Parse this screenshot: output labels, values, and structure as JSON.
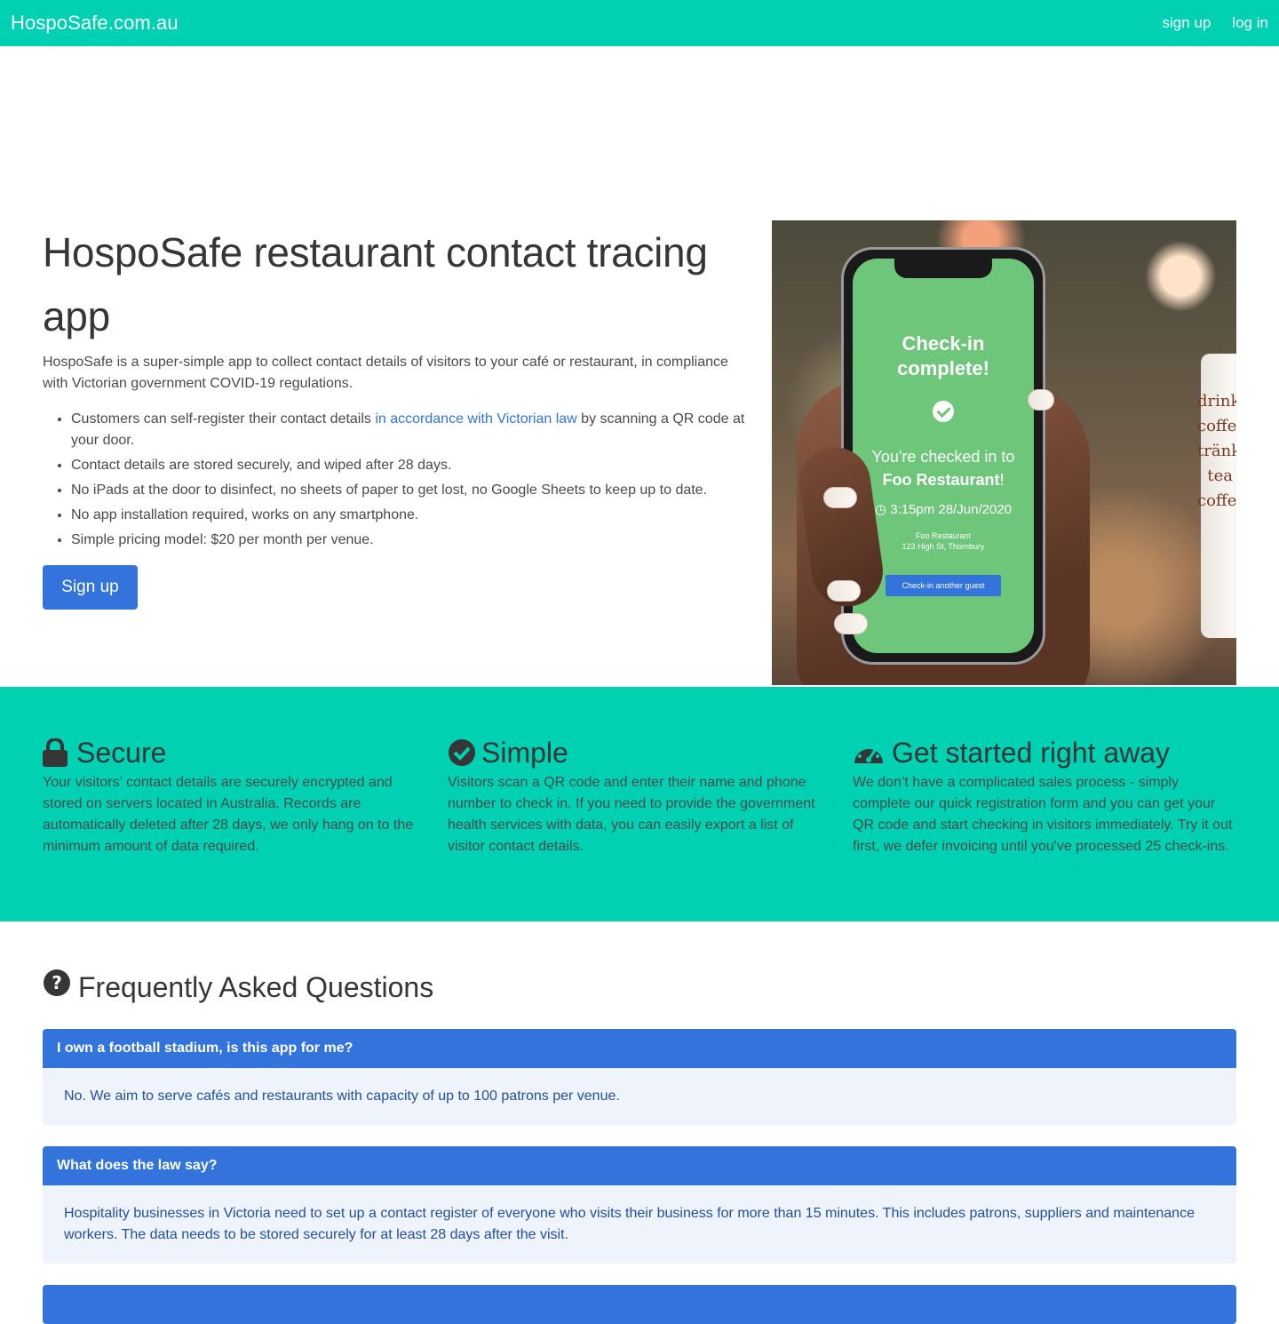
{
  "nav": {
    "brand": "HospoSafe.com.au",
    "signup": "sign up",
    "login": "log in"
  },
  "hero": {
    "title": "HospoSafe restaurant contact tracing app",
    "lead": "HospoSafe is a super-simple app to collect contact details of visitors to your café or restaurant, in compliance with Victorian government COVID-19 regulations.",
    "bullets": {
      "b1_pre": "Customers can self-register their contact details ",
      "b1_link": "in accordance with Victorian law",
      "b1_post": " by scanning a QR code at your door.",
      "b2": "Contact details are stored securely, and wiped after 28 days.",
      "b3": "No iPads at the door to disinfect, no sheets of paper to get lost, no Google Sheets to keep up to date.",
      "b4": "No app installation required, works on any smartphone.",
      "b5": "Simple pricing model: $20 per month per venue."
    },
    "signup_button": "Sign up"
  },
  "phone_screen": {
    "title_line1": "Check-in",
    "title_line2": "complete!",
    "checked_in": "You're checked in to",
    "venue_bold": "Foo Restaurant",
    "venue_suffix": "!",
    "time": "3:15pm 28/Jun/2020",
    "venue_name": "Foo Restaurant",
    "venue_address": "123 High St, Thornbury",
    "button": "Check-in another guest"
  },
  "cup_text": "drinks coffee tränk tea coffe",
  "features": [
    {
      "icon": "lock-icon",
      "title": "Secure",
      "text": "Your visitors’ contact details are securely encrypted and stored on servers located in Australia. Records are automatically deleted after 28 days, we only hang on to the minimum amount of data required."
    },
    {
      "icon": "check-circle-icon",
      "title": "Simple",
      "text": "Visitors scan a QR code and enter their name and phone number to check in. If you need to provide the government health services with data, you can easily export a list of visitor contact details."
    },
    {
      "icon": "speedometer-icon",
      "title": "Get started right away",
      "text": "We don’t have a complicated sales process - simply complete our quick registration form and you can get your QR code and start checking in visitors immediately. Try it out first, we defer invoicing until you've processed 25 check-ins."
    }
  ],
  "faq": {
    "title": "Frequently Asked Questions",
    "items": [
      {
        "q": "I own a football stadium, is this app for me?",
        "a": "No. We aim to serve cafés and restaurants with capacity of up to 100 patrons per venue."
      },
      {
        "q": "What does the law say?",
        "a": "Hospitality businesses in Victoria need to set up a contact register of everyone who visits their business for more than 15 minutes. This includes patrons, suppliers and maintenance workers. The data needs to be stored securely for at least 28 days after the visit."
      }
    ]
  },
  "colors": {
    "primary": "#00d1b2",
    "link": "#3273dc",
    "text": "#4a4a4a"
  }
}
